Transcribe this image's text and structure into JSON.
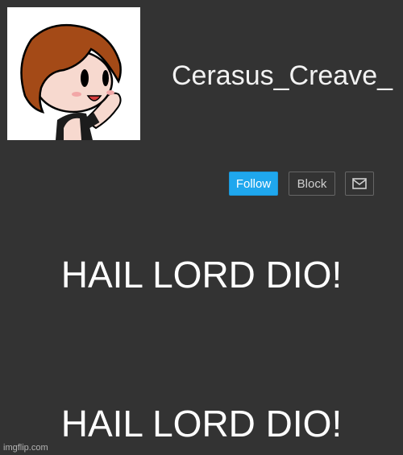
{
  "profile": {
    "username": "Cerasus_Creave_"
  },
  "actions": {
    "follow_label": "Follow",
    "block_label": "Block",
    "message_icon": "envelope-icon"
  },
  "meme": {
    "top_text": "HAIL LORD DIO!",
    "bottom_text": "HAIL LORD DIO!"
  },
  "watermark": "imgflip.com",
  "colors": {
    "background": "#333333",
    "follow_button": "#1fa7ee",
    "text": "#ffffff"
  }
}
